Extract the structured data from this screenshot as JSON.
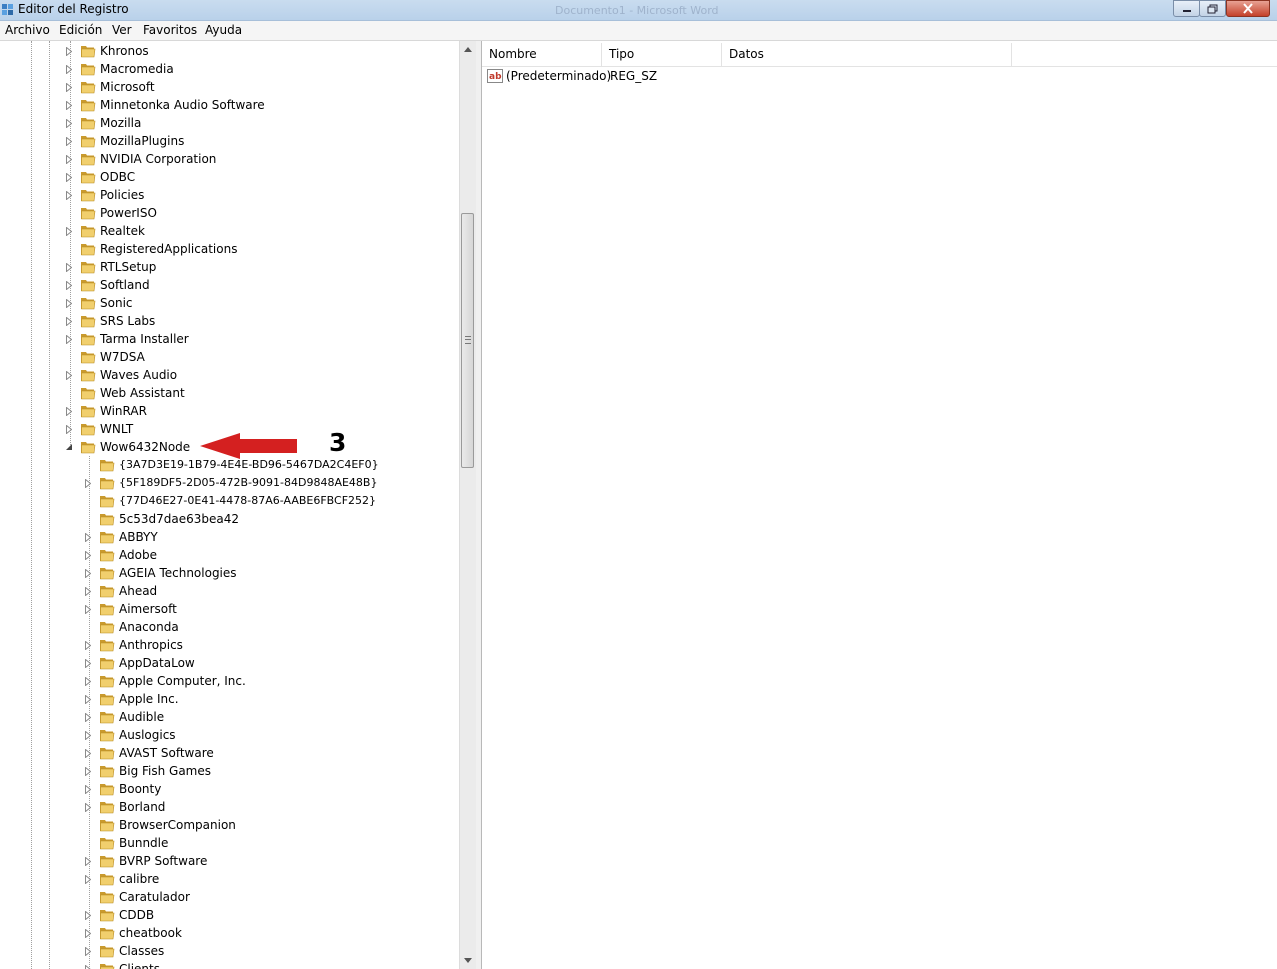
{
  "window": {
    "title": "Editor del Registro",
    "ghost_title": "Documento1 - Microsoft Word"
  },
  "menu": [
    "Archivo",
    "Edición",
    "Ver",
    "Favoritos",
    "Ayuda"
  ],
  "tree": {
    "top_level": [
      {
        "label": "Khronos",
        "expandable": true
      },
      {
        "label": "Macromedia",
        "expandable": true
      },
      {
        "label": "Microsoft",
        "expandable": true
      },
      {
        "label": "Minnetonka Audio Software",
        "expandable": true
      },
      {
        "label": "Mozilla",
        "expandable": true
      },
      {
        "label": "MozillaPlugins",
        "expandable": true
      },
      {
        "label": "NVIDIA Corporation",
        "expandable": true
      },
      {
        "label": "ODBC",
        "expandable": true
      },
      {
        "label": "Policies",
        "expandable": true
      },
      {
        "label": "PowerISO",
        "expandable": false
      },
      {
        "label": "Realtek",
        "expandable": true
      },
      {
        "label": "RegisteredApplications",
        "expandable": false
      },
      {
        "label": "RTLSetup",
        "expandable": true
      },
      {
        "label": "Softland",
        "expandable": true
      },
      {
        "label": "Sonic",
        "expandable": true
      },
      {
        "label": "SRS Labs",
        "expandable": true
      },
      {
        "label": "Tarma Installer",
        "expandable": true
      },
      {
        "label": "W7DSA",
        "expandable": false
      },
      {
        "label": "Waves Audio",
        "expandable": true
      },
      {
        "label": "Web Assistant",
        "expandable": false
      },
      {
        "label": "WinRAR",
        "expandable": true
      },
      {
        "label": "WNLT",
        "expandable": true
      },
      {
        "label": "Wow6432Node",
        "expandable": true,
        "expanded": true
      }
    ],
    "children": [
      {
        "label": "{3A7D3E19-1B79-4E4E-BD96-5467DA2C4EF0}",
        "expandable": false,
        "guid": true
      },
      {
        "label": "{5F189DF5-2D05-472B-9091-84D9848AE48B}",
        "expandable": true,
        "guid": true
      },
      {
        "label": "{77D46E27-0E41-4478-87A6-AABE6FBCF252}",
        "expandable": false,
        "guid": true
      },
      {
        "label": "5c53d7dae63bea42",
        "expandable": false
      },
      {
        "label": "ABBYY",
        "expandable": true
      },
      {
        "label": "Adobe",
        "expandable": true
      },
      {
        "label": "AGEIA Technologies",
        "expandable": true
      },
      {
        "label": "Ahead",
        "expandable": true
      },
      {
        "label": "Aimersoft",
        "expandable": true
      },
      {
        "label": "Anaconda",
        "expandable": false
      },
      {
        "label": "Anthropics",
        "expandable": true
      },
      {
        "label": "AppDataLow",
        "expandable": true
      },
      {
        "label": "Apple Computer, Inc.",
        "expandable": true
      },
      {
        "label": "Apple Inc.",
        "expandable": true
      },
      {
        "label": "Audible",
        "expandable": true
      },
      {
        "label": "Auslogics",
        "expandable": true
      },
      {
        "label": "AVAST Software",
        "expandable": true
      },
      {
        "label": "Big Fish Games",
        "expandable": true
      },
      {
        "label": "Boonty",
        "expandable": true
      },
      {
        "label": "Borland",
        "expandable": true
      },
      {
        "label": "BrowserCompanion",
        "expandable": false
      },
      {
        "label": "Bunndle",
        "expandable": false
      },
      {
        "label": "BVRP Software",
        "expandable": true
      },
      {
        "label": "calibre",
        "expandable": true
      },
      {
        "label": "Caratulador",
        "expandable": false
      },
      {
        "label": "CDDB",
        "expandable": true
      },
      {
        "label": "cheatbook",
        "expandable": true
      },
      {
        "label": "Classes",
        "expandable": true
      },
      {
        "label": "Clients",
        "expandable": true
      }
    ]
  },
  "list": {
    "headers": {
      "name": "Nombre",
      "type": "Tipo",
      "data": "Datos"
    },
    "rows": [
      {
        "name": "(Predeterminado)",
        "type": "REG_SZ",
        "data": ""
      }
    ]
  },
  "annotation": {
    "number": "3",
    "color": "#d42020"
  },
  "colors": {
    "folder": "#e8c25a",
    "folder_dark": "#b88a1e",
    "annotation_red": "#d42020"
  }
}
